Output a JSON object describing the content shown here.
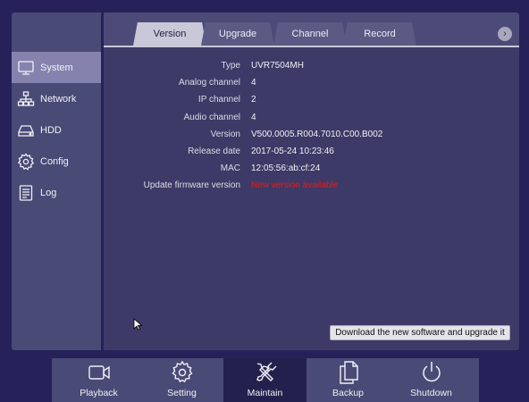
{
  "sidebar": {
    "items": [
      {
        "label": "System",
        "icon": "monitor-icon",
        "active": true
      },
      {
        "label": "Network",
        "icon": "network-icon"
      },
      {
        "label": "HDD",
        "icon": "hdd-icon"
      },
      {
        "label": "Config",
        "icon": "gear-icon"
      },
      {
        "label": "Log",
        "icon": "log-icon"
      }
    ]
  },
  "tabs": [
    {
      "label": "Version",
      "active": true
    },
    {
      "label": "Upgrade"
    },
    {
      "label": "Channel"
    },
    {
      "label": "Record"
    }
  ],
  "tab_next_glyph": "›",
  "info": {
    "rows": [
      {
        "label": "Type",
        "value": "UVR7504MH"
      },
      {
        "label": "Analog channel",
        "value": "4"
      },
      {
        "label": "IP channel",
        "value": "2"
      },
      {
        "label": "Audio channel",
        "value": "4"
      },
      {
        "label": "Version",
        "value": "V500.0005.R004.7010.C00.B002"
      },
      {
        "label": "Release date",
        "value": "2017-05-24 10:23:46"
      },
      {
        "label": "MAC",
        "value": "12:05:56:ab:cf:24"
      },
      {
        "label": "Update firmware version",
        "value": "New version available"
      }
    ]
  },
  "download_button": "Download the new software and upgrade it",
  "bottombar": {
    "items": [
      {
        "label": "Playback",
        "icon": "camera-icon"
      },
      {
        "label": "Setting",
        "icon": "gear-icon"
      },
      {
        "label": "Maintain",
        "icon": "tools-icon",
        "active": true
      },
      {
        "label": "Backup",
        "icon": "documents-icon"
      },
      {
        "label": "Shutdown",
        "icon": "power-icon"
      }
    ]
  },
  "colors": {
    "background": "#262159",
    "panel": "#3d3a67",
    "sidebar": "#4a4a76",
    "active_item": "#8583ad",
    "alert_red": "#e21b1b"
  }
}
